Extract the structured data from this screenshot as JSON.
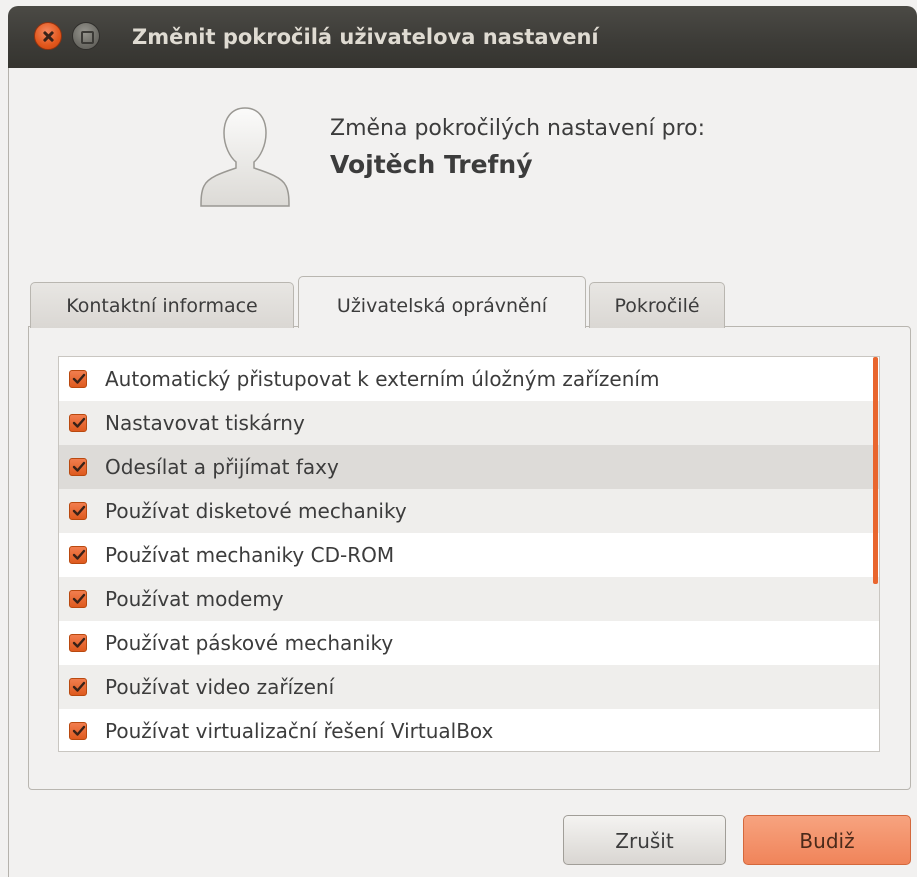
{
  "window": {
    "title": "Změnit pokročilá uživatelova nastavení"
  },
  "header": {
    "subtitle": "Změna pokročilých nastavení pro:",
    "username": "Vojtěch Trefný"
  },
  "tabs": [
    {
      "label": "Kontaktní informace",
      "active": false
    },
    {
      "label": "Uživatelská oprávnění",
      "active": true
    },
    {
      "label": "Pokročilé",
      "active": false
    }
  ],
  "permissions": [
    {
      "label": "Automatický přistupovat k externím úložným zařízením",
      "checked": true
    },
    {
      "label": "Nastavovat tiskárny",
      "checked": true
    },
    {
      "label": "Odesílat a přijímat faxy",
      "checked": true
    },
    {
      "label": "Používat disketové mechaniky",
      "checked": true
    },
    {
      "label": "Používat mechaniky CD-ROM",
      "checked": true
    },
    {
      "label": "Používat modemy",
      "checked": true
    },
    {
      "label": "Používat páskové mechaniky",
      "checked": true
    },
    {
      "label": "Používat video zařízení",
      "checked": true
    },
    {
      "label": "Používat virtualizační řešení VirtualBox",
      "checked": true
    }
  ],
  "buttons": {
    "cancel": "Zrušit",
    "ok": "Budiž"
  },
  "colors": {
    "accent": "#e9662e",
    "titlebar": "#3c3b37",
    "window_bg": "#f2f1f0"
  },
  "icons": {
    "avatar": "user-silhouette-icon",
    "check": "checkbox-checked-icon"
  }
}
